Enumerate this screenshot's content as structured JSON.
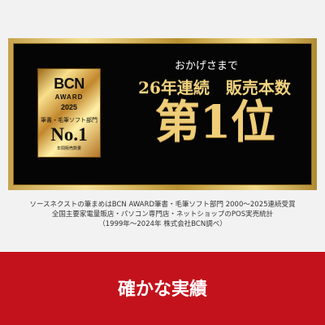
{
  "award": {
    "badge": {
      "bcn": "BCN",
      "award": "AWARD",
      "year": "2025",
      "category": "筆書・毛筆ソフト部門",
      "rank": "No.1",
      "sub": "年間販売数量"
    },
    "intro": "おかげさまで",
    "headline": "26年連続　販売本数",
    "rank": "第1位"
  },
  "notes": [
    "ソースネクストの筆まめはBCN AWARD筆書・毛筆ソフト部門 2000〜2025連続受賞",
    "全国主要家電量販店・パソコン専門店・ネットショップのPOS実売統計",
    "（1999年〜2024年 株式会社BCN調べ）"
  ],
  "footer": {
    "text": "確かな実績"
  },
  "colors": {
    "banner": "#c3121c",
    "gold": "#efcd79",
    "panel": "#050505"
  }
}
